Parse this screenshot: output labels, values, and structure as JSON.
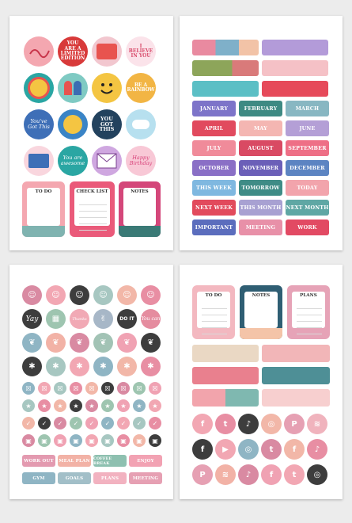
{
  "sheet1": {
    "circle_texts": [
      "",
      "YOU ARE A LIMITED EDITION",
      "",
      "I BELIEVE IN YOU",
      "",
      "",
      "",
      "BE A RAINBOW",
      "You've Got This",
      "",
      "YOU GOT THIS",
      "",
      "",
      "You are awesome",
      "",
      "Happy Birthday"
    ],
    "notes": [
      "TO DO",
      "CHECK LIST",
      "NOTES"
    ]
  },
  "sheet2": {
    "labels": [
      "JANUARY",
      "FEBRUARY",
      "MARCH",
      "APRIL",
      "MAY",
      "JUNE",
      "JULY",
      "AUGUST",
      "SEPTEMBER",
      "OCTOBER",
      "NOVEMBER",
      "DECEMBER",
      "THIS WEEK",
      "TOMORROW",
      "TODAY",
      "NEXT WEEK",
      "THIS MONTH",
      "NEXT MONTH",
      "IMPORTANT",
      "MEETING",
      "WORK"
    ]
  },
  "sheet3": {
    "script_words": [
      "Yay",
      "Thanks",
      "DO IT",
      "You can"
    ],
    "labels": [
      "WORK OUT",
      "MEAL PLAN",
      "COFFEE BREAK",
      "ENJOY",
      "GYM",
      "GOALS",
      "PLANS",
      "MEETING"
    ]
  },
  "sheet4": {
    "notes": [
      "TO DO",
      "NOTES",
      "PLANS"
    ],
    "social": [
      "f",
      "t",
      "♪",
      "◎",
      "P",
      "≋",
      "f",
      "▶",
      "◎",
      "t",
      "f",
      "♪",
      "P",
      "≋",
      "♪",
      "f",
      "t",
      "◎"
    ]
  }
}
